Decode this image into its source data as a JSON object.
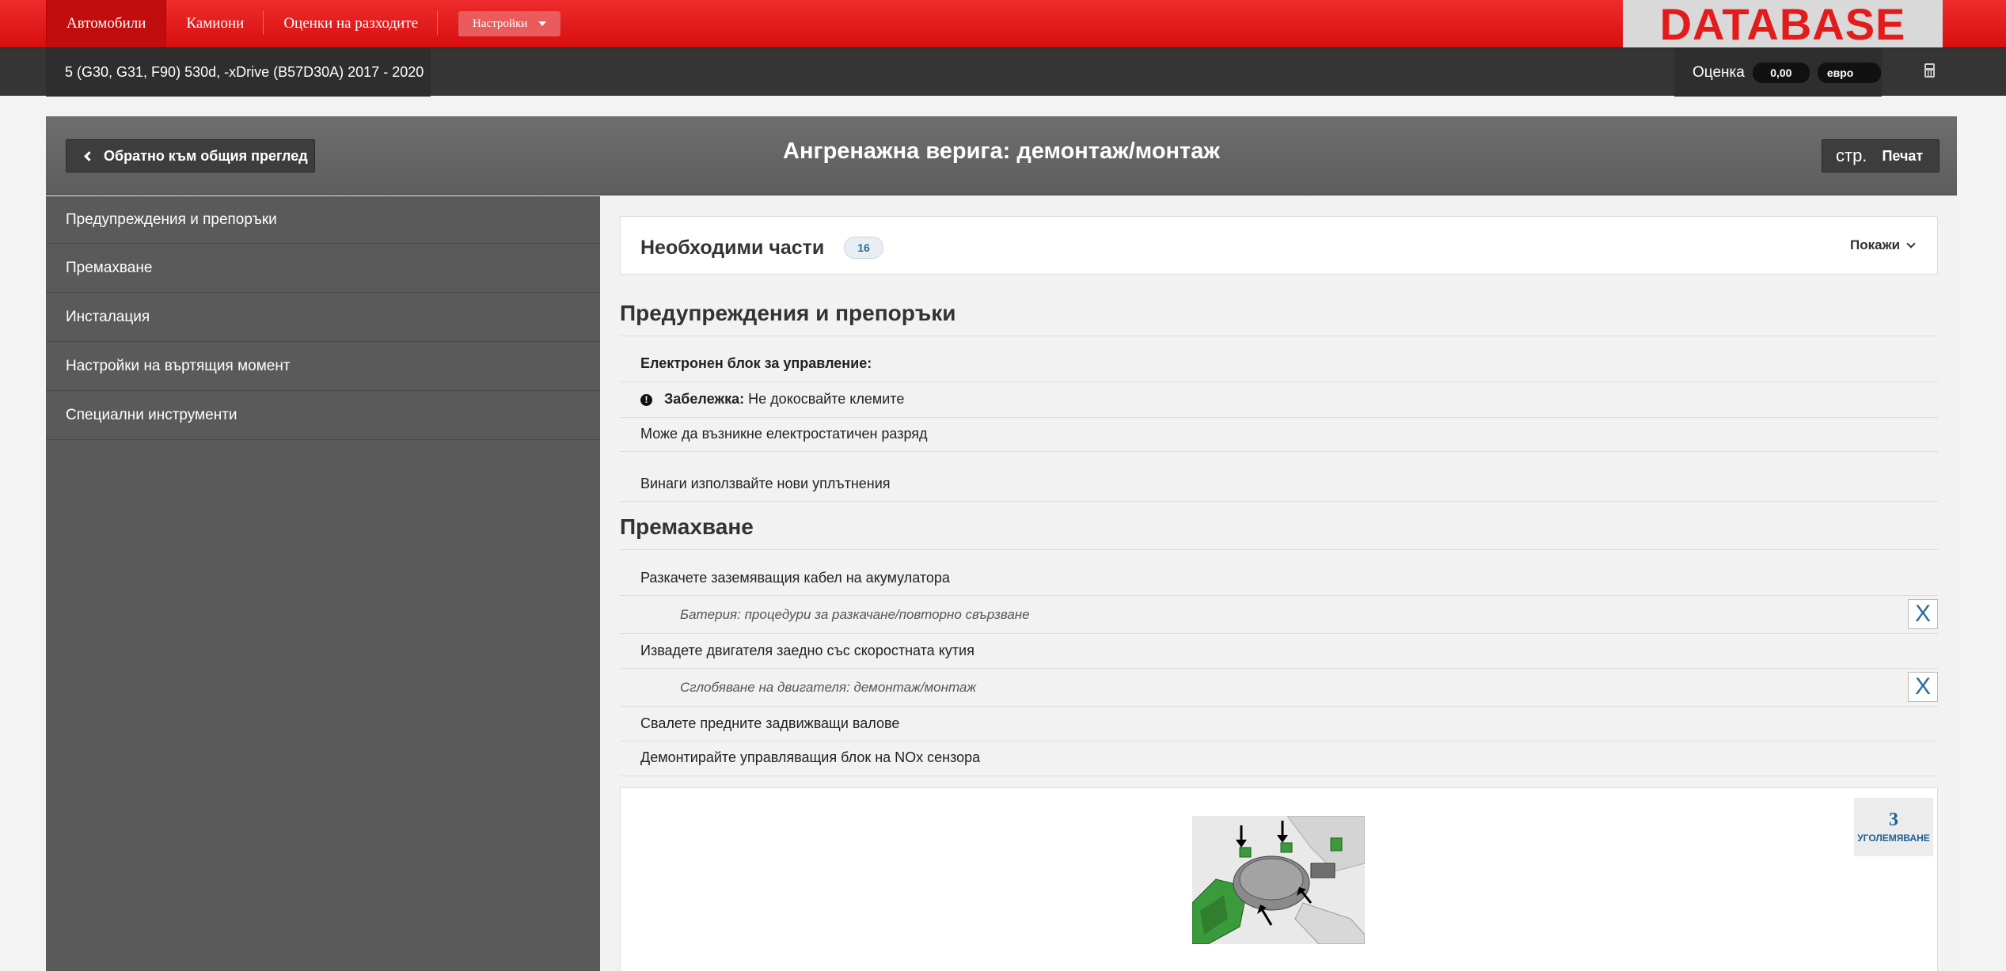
{
  "topnav": {
    "items": [
      {
        "label": "Автомобили",
        "active": true
      },
      {
        "label": "Камиони",
        "active": false
      },
      {
        "label": "Оценки на разходите",
        "active": false
      }
    ],
    "settings_label": "Настройки",
    "logo_text": "DATABASE"
  },
  "subbar": {
    "vehicle": "5 (G30, G31, F90) 530d, -xDrive (B57D30A) 2017 - 2020",
    "estimate_label": "Оценка",
    "estimate_value": "0,00",
    "currency": "евро",
    "calculator_icon": "calculator-icon"
  },
  "header": {
    "back_label": "Обратно към общия преглед",
    "title": "Ангренажна верига: демонтаж/монтаж",
    "page_label": "стр.",
    "print_label": "Печат"
  },
  "sidebar": {
    "items": [
      {
        "label": "Предупреждения и препоръки"
      },
      {
        "label": "Премахване"
      },
      {
        "label": "Инсталация"
      },
      {
        "label": "Настройки на въртящия момент"
      },
      {
        "label": "Специални инструменти"
      }
    ]
  },
  "parts": {
    "title": "Необходими части",
    "count": "16",
    "show_label": "Покажи"
  },
  "warnings": {
    "title": "Предупреждения и препоръки",
    "ecu_heading": "Електронен блок за управление:",
    "note_label": "Забележка:",
    "note_text": " Не докосвайте клемите",
    "static_text": "Може да възникне електростатичен разряд",
    "seals_text": "Винаги използвайте нови уплътнения"
  },
  "removal": {
    "title": "Премахване",
    "steps": [
      {
        "text": "Разкачете заземяващия кабел на акумулатора"
      },
      {
        "text": "Батерия: процедури за разкачане/повторно свързване",
        "ref": true,
        "close_label": "X"
      },
      {
        "text": "Извадете двигателя заедно със скоростната кутия"
      },
      {
        "text": "Сглобяване на двигателя: демонтаж/монтаж",
        "ref": true,
        "close_label": "X"
      },
      {
        "text": "Свалете предните задвижващи валове"
      },
      {
        "text": "Демонтирайте управляващия блок на NOx сензора"
      }
    ]
  },
  "image": {
    "zoom_number": "3",
    "zoom_label": "УГОЛЕМЯВАНЕ"
  }
}
